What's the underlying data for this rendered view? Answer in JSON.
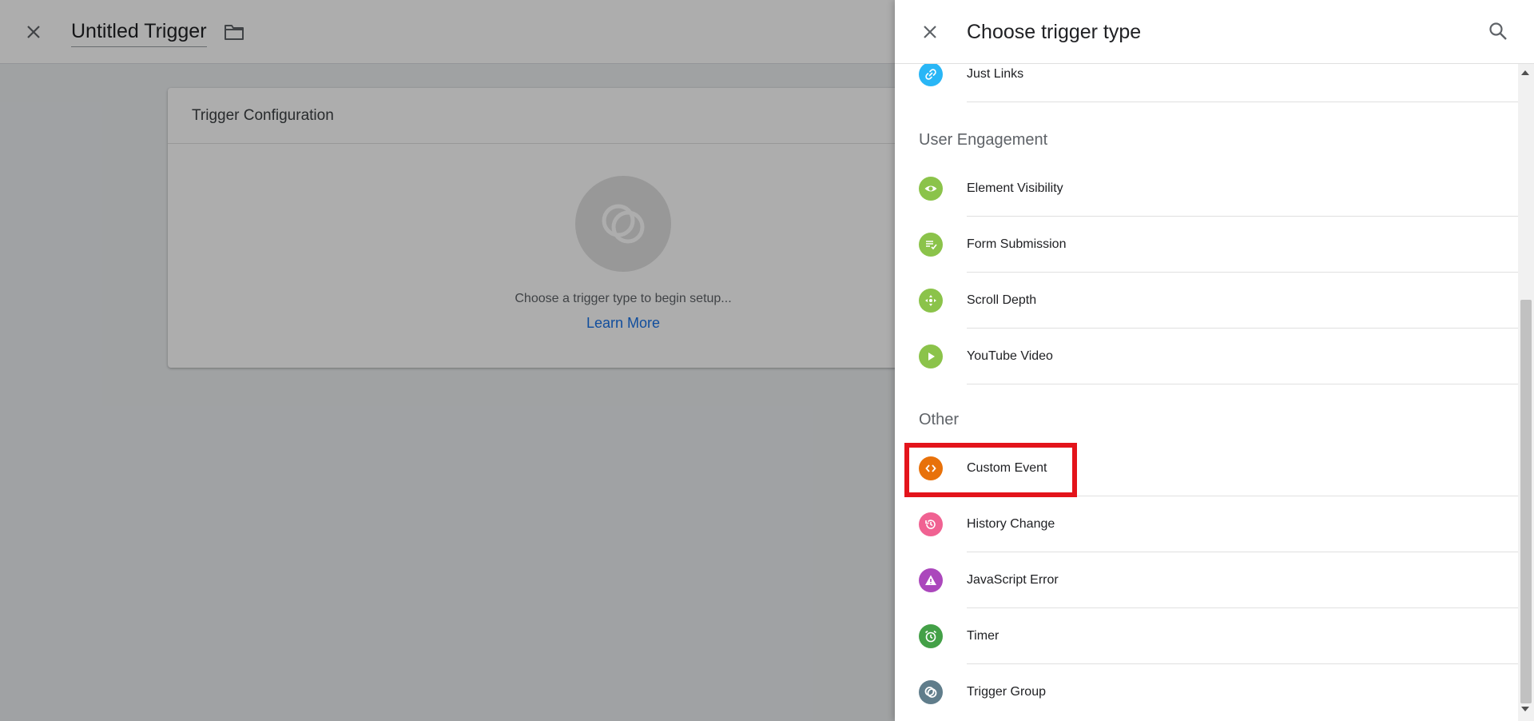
{
  "background": {
    "trigger_name": "Untitled Trigger",
    "config_title": "Trigger Configuration",
    "config_hint": "Choose a trigger type to begin setup...",
    "learn_more": "Learn More"
  },
  "panel": {
    "title": "Choose trigger type",
    "items_top": [
      {
        "label": "Just Links",
        "icon": "link-icon",
        "color": "#29b6f6"
      }
    ],
    "sections": [
      {
        "heading": "User Engagement",
        "items": [
          {
            "label": "Element Visibility",
            "icon": "eye-icon",
            "color": "#8bc34a"
          },
          {
            "label": "Form Submission",
            "icon": "form-check-icon",
            "color": "#8bc34a"
          },
          {
            "label": "Scroll Depth",
            "icon": "scroll-arrows-icon",
            "color": "#8bc34a"
          },
          {
            "label": "YouTube Video",
            "icon": "play-icon",
            "color": "#8bc34a"
          }
        ]
      },
      {
        "heading": "Other",
        "items": [
          {
            "label": "Custom Event",
            "icon": "code-brackets-icon",
            "color": "#e8710a"
          },
          {
            "label": "History Change",
            "icon": "history-icon",
            "color": "#f06292"
          },
          {
            "label": "JavaScript Error",
            "icon": "warning-icon",
            "color": "#ab47bc"
          },
          {
            "label": "Timer",
            "icon": "alarm-clock-icon",
            "color": "#43a047"
          },
          {
            "label": "Trigger Group",
            "icon": "trigger-group-icon",
            "color": "#607d8b"
          }
        ]
      }
    ]
  },
  "highlight_color": "#e3141b"
}
